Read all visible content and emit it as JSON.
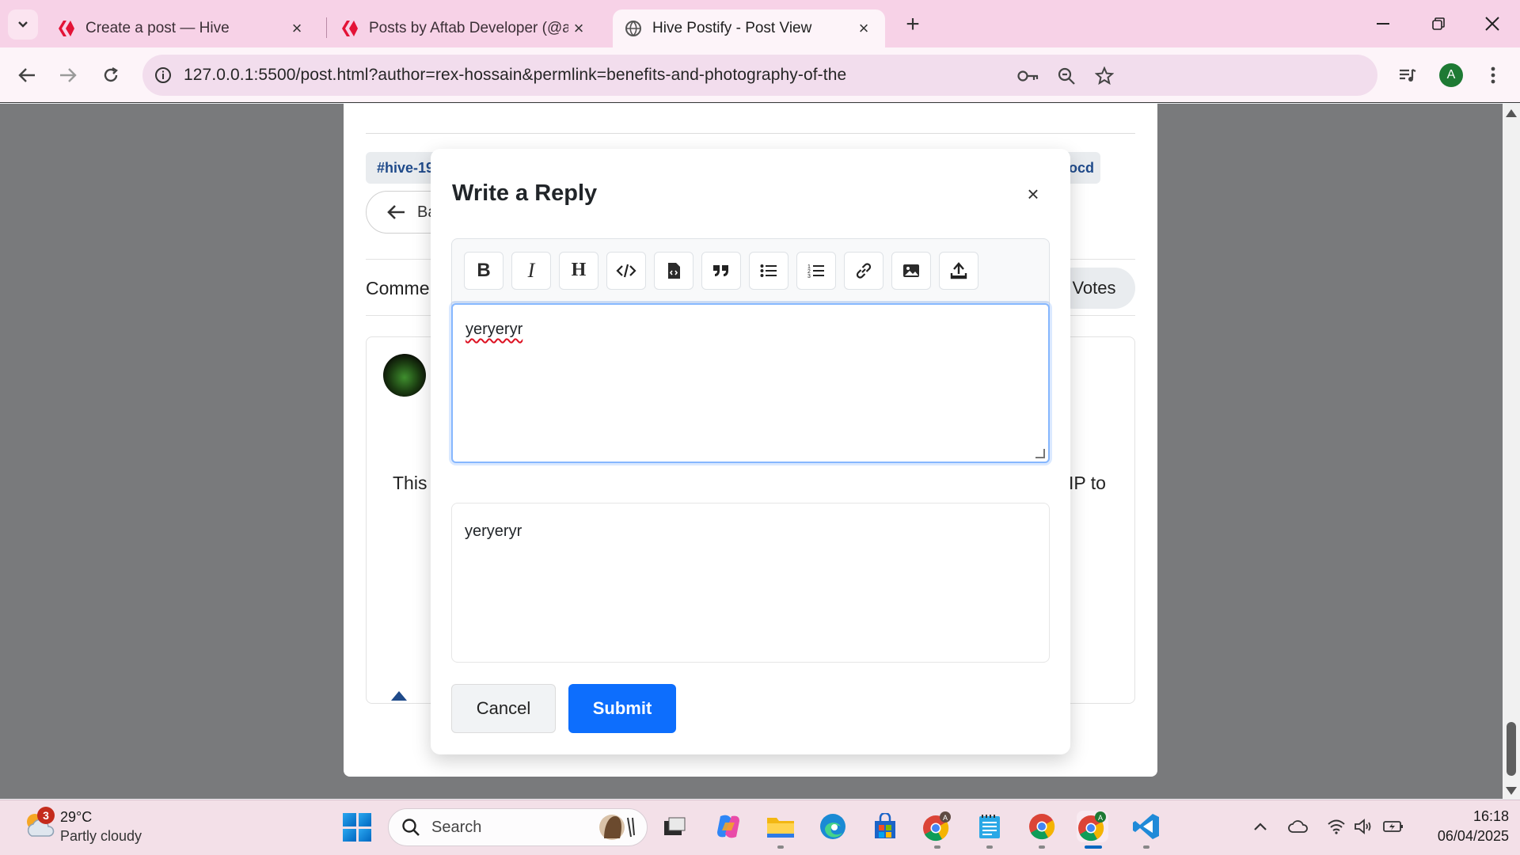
{
  "browser": {
    "tabs": [
      {
        "label": "Create a post — Hive",
        "icon": "hive-icon"
      },
      {
        "label": "Posts by Aftab Developer (@aft",
        "icon": "hive-icon"
      },
      {
        "label": "Hive Postify - Post View",
        "icon": "globe-icon",
        "active": true
      }
    ],
    "new_tab_label": "+",
    "url": "127.0.0.1:5500/post.html?author=rex-hossain&permlink=benefits-and-photography-of-the",
    "profile_initial": "A"
  },
  "page": {
    "tag_left": "#hive-19",
    "tag_right": "ocd",
    "back_label": "Ba",
    "comments_label": "Comme",
    "votes_label": "Votes",
    "comment_text_left": "This",
    "comment_text_right": "IP to"
  },
  "modal": {
    "title": "Write a Reply",
    "close_label": "×",
    "toolbar": [
      {
        "name": "bold-icon",
        "glyph": "B"
      },
      {
        "name": "italic-icon",
        "glyph": "I"
      },
      {
        "name": "heading-icon",
        "glyph": "H"
      },
      {
        "name": "code-icon",
        "glyph": "</>"
      },
      {
        "name": "code-file-icon",
        "glyph": "file"
      },
      {
        "name": "quote-icon",
        "glyph": "99"
      },
      {
        "name": "bullet-list-icon",
        "glyph": "ul"
      },
      {
        "name": "numbered-list-icon",
        "glyph": "ol"
      },
      {
        "name": "link-icon",
        "glyph": "link"
      },
      {
        "name": "image-icon",
        "glyph": "img"
      },
      {
        "name": "upload-icon",
        "glyph": "up"
      }
    ],
    "textarea_value": "yeryeryr",
    "preview_value": "yeryeryr",
    "cancel_label": "Cancel",
    "submit_label": "Submit",
    "accent_color": "#0d6efd"
  },
  "taskbar": {
    "weather_badge": "3",
    "weather_temp": "29°C",
    "weather_desc": "Partly cloudy",
    "search_label": "Search",
    "time": "16:18",
    "date": "06/04/2025"
  }
}
